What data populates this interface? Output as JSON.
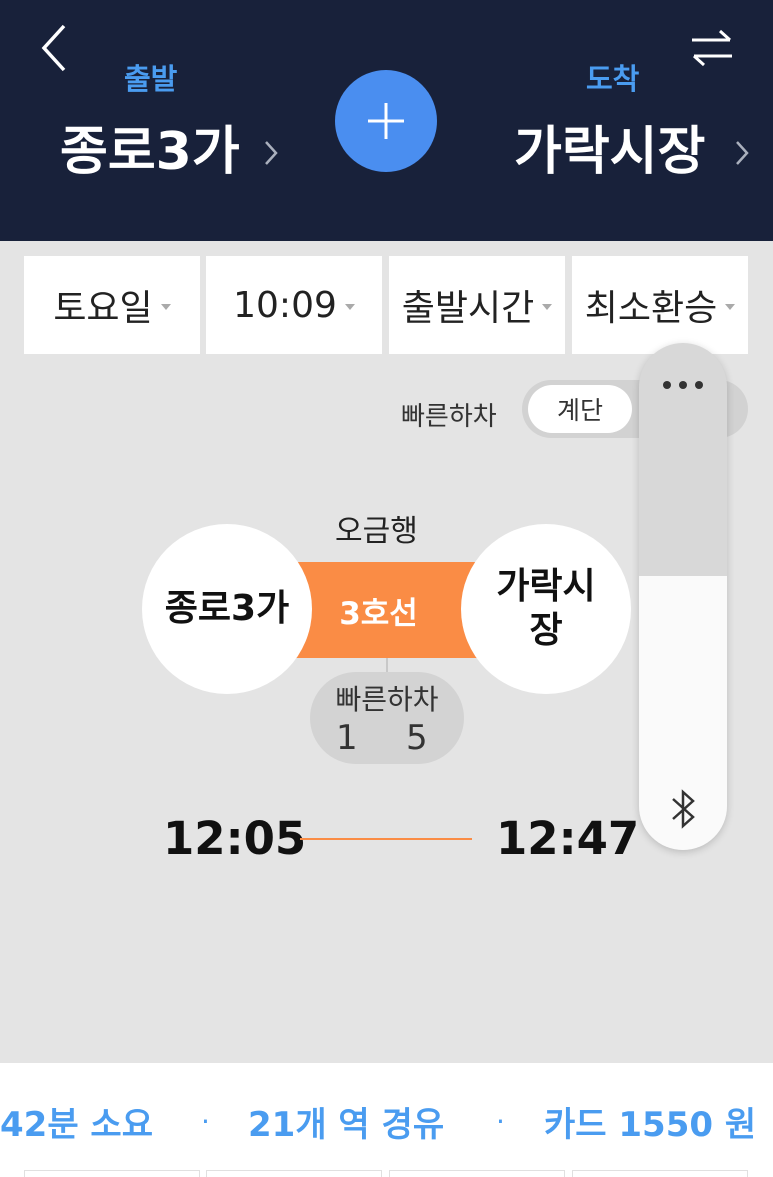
{
  "header": {
    "departure_label": "출발",
    "arrival_label": "도착",
    "departure_station": "종로3가",
    "arrival_station": "가락시장"
  },
  "options": {
    "day": "토요일",
    "time": "10:09",
    "time_mode": "출발시간",
    "route_mode": "최소환승"
  },
  "fast_exit": {
    "label": "빠른하차",
    "toggle_value": "계단"
  },
  "route": {
    "direction": "오금행",
    "line_name": "3호선",
    "line_color": "#fa8c45",
    "from_station": "종로3가",
    "to_station": "가락시장",
    "fast_exit_title": "빠른하차",
    "fast_exit_car_1": "1",
    "fast_exit_car_2": "5",
    "depart_time": "12:05",
    "arrive_time": "12:47"
  },
  "summary": {
    "duration": "42분 소요",
    "stops": "21개 역 경유",
    "fare": "카드 1550 원",
    "separator": "·"
  },
  "overlay": {
    "more_icon": "more-horizontal-icon",
    "bluetooth_icon": "bluetooth-icon",
    "level_fraction": 0.54
  },
  "colors": {
    "header_bg": "#18213a",
    "accent_blue": "#4a9cf0",
    "add_button": "#4a8ef0"
  }
}
